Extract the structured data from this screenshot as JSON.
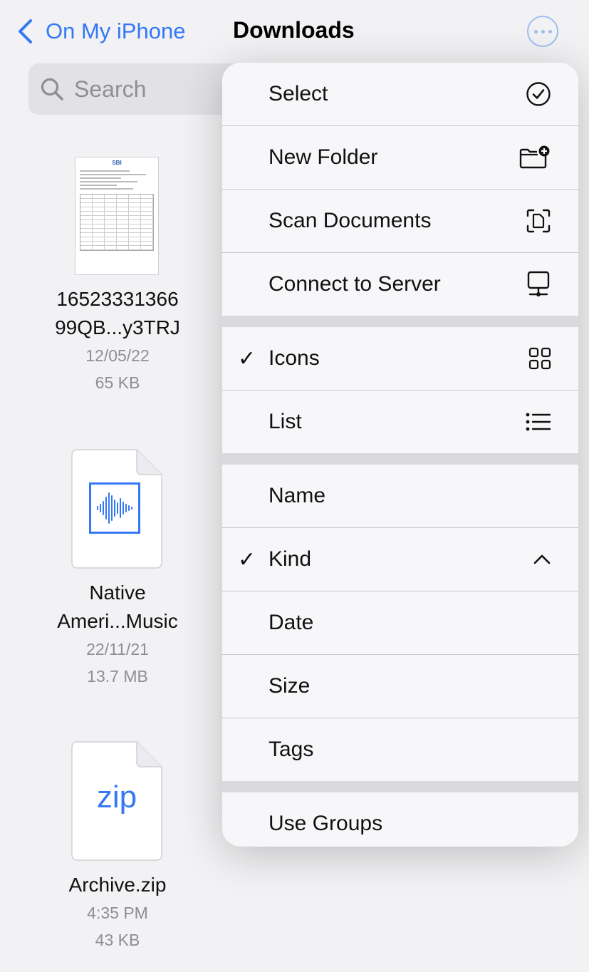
{
  "header": {
    "back_label": "On My iPhone",
    "title": "Downloads"
  },
  "search": {
    "placeholder": "Search"
  },
  "files": [
    {
      "name_line1": "16523331366",
      "name_line2": "99QB...y3TRJ",
      "date": "12/05/22",
      "size": "65 KB",
      "thumb_text": "SBI"
    },
    {
      "name_line1": "Native",
      "name_line2": "Ameri...Music",
      "date": "22/11/21",
      "size": "13.7 MB"
    },
    {
      "name_line1": "Archive.zip",
      "date": "4:35 PM",
      "size": "43 KB",
      "thumb_text": "zip"
    }
  ],
  "menu": {
    "group1": [
      {
        "label": "Select",
        "icon": "checkmark-circle-icon"
      },
      {
        "label": "New Folder",
        "icon": "folder-plus-icon"
      },
      {
        "label": "Scan Documents",
        "icon": "scan-doc-icon"
      },
      {
        "label": "Connect to Server",
        "icon": "server-display-icon"
      }
    ],
    "group2": [
      {
        "label": "Icons",
        "checked": true,
        "icon": "grid-icon"
      },
      {
        "label": "List",
        "checked": false,
        "icon": "list-icon"
      }
    ],
    "group3": [
      {
        "label": "Name",
        "checked": false
      },
      {
        "label": "Kind",
        "checked": true,
        "icon": "chevron-up-icon"
      },
      {
        "label": "Date",
        "checked": false
      },
      {
        "label": "Size",
        "checked": false
      },
      {
        "label": "Tags",
        "checked": false
      }
    ],
    "group4": [
      {
        "label": "Use Groups"
      }
    ],
    "check_glyph": "✓"
  },
  "colors": {
    "accent": "#3478f6",
    "background": "#f2f2f4",
    "menu": "#f7f7f9"
  }
}
